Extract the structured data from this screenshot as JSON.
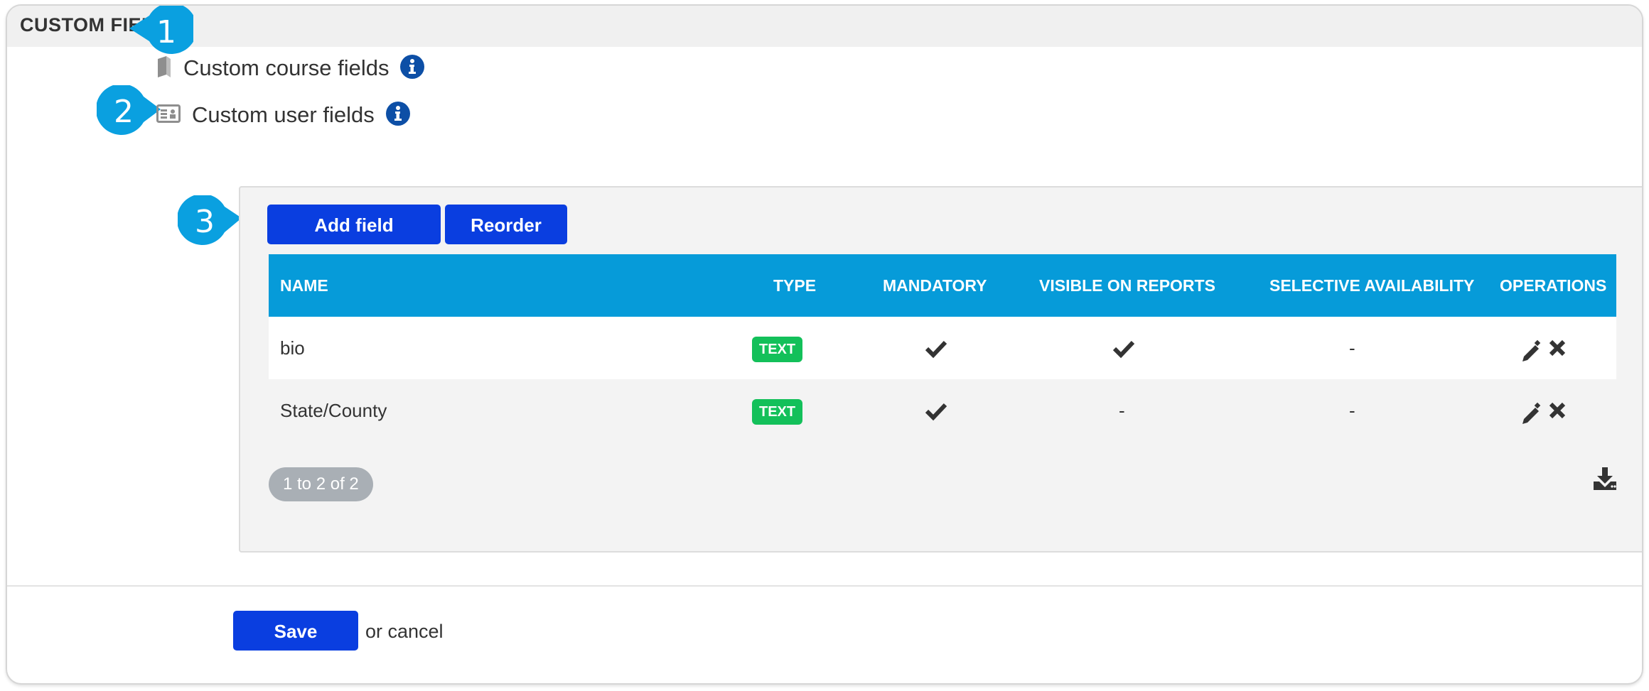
{
  "section": {
    "title": "CUSTOM FIELDS"
  },
  "callouts": [
    "1",
    "2",
    "3"
  ],
  "links": [
    {
      "label": "Custom course fields",
      "icon": "book-icon"
    },
    {
      "label": "Custom user fields",
      "icon": "id-card-icon"
    }
  ],
  "toolbar": {
    "add_label": "Add field",
    "reorder_label": "Reorder"
  },
  "table": {
    "headers": [
      "NAME",
      "TYPE",
      "MANDATORY",
      "VISIBLE ON REPORTS",
      "SELECTIVE AVAILABILITY",
      "OPERATIONS"
    ],
    "rows": [
      {
        "name": "bio",
        "type": "TEXT",
        "mandatory": true,
        "visible": true,
        "selective": "-"
      },
      {
        "name": "State/County",
        "type": "TEXT",
        "mandatory": true,
        "visible": "-",
        "selective": "-"
      }
    ],
    "dash": "-"
  },
  "pagination": "1 to 2 of 2",
  "footer": {
    "save_label": "Save",
    "cancel_text": "or cancel"
  },
  "colors": {
    "primary_button": "#0a3ee0",
    "table_header": "#069bd9",
    "badge": "#13c05a",
    "callout": "#0aa0e0",
    "info_icon": "#0d4fa6"
  }
}
